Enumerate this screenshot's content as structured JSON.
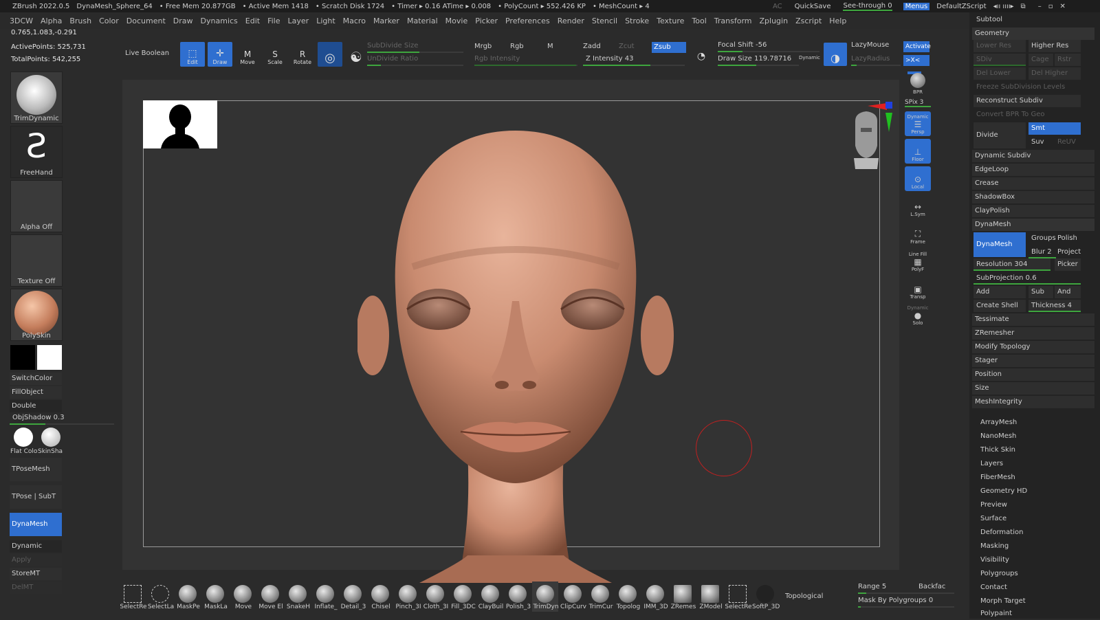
{
  "titlebar": {
    "app": "ZBrush 2022.0.5",
    "doc": "DynaMesh_Sphere_64",
    "free_mem": "• Free Mem 20.877GB",
    "active_mem": "• Active Mem 1418",
    "scratch": "• Scratch Disk 1724",
    "timer": "• Timer ▸ 0.16 ATime ▸ 0.008",
    "poly": "• PolyCount ▸ 552.426 KP",
    "mesh": "• MeshCount ▸ 4",
    "ac": "AC",
    "quicksave": "QuickSave",
    "seethrough": "See-through  0",
    "menus": "Menus",
    "script": "DefaultZScript"
  },
  "menu": [
    "3DCW",
    "Alpha",
    "Brush",
    "Color",
    "Document",
    "Draw",
    "Dynamics",
    "Edit",
    "File",
    "Layer",
    "Light",
    "Macro",
    "Marker",
    "Material",
    "Movie",
    "Picker",
    "Preferences",
    "Render",
    "Stencil",
    "Stroke",
    "Texture",
    "Tool",
    "Transform",
    "Zplugin",
    "Zscript",
    "Help"
  ],
  "coords": "0.765,1.083,-0.291",
  "stats": {
    "active": "ActivePoints: 525,731",
    "total": "TotalPoints: 542,255"
  },
  "toolbar": {
    "live_boolean": "Live Boolean",
    "edit": "Edit",
    "draw": "Draw",
    "move": "Move",
    "scale": "Scale",
    "rotate": "Rotate",
    "subdivide_size": "SubDivide Size",
    "undivide_ratio": "UnDivide Ratio",
    "mrgb": "Mrgb",
    "rgb": "Rgb",
    "m": "M",
    "rgb_intensity": "Rgb Intensity",
    "zadd": "Zadd",
    "zcut": "Zcut",
    "zsub": "Zsub",
    "z_intensity": "Z Intensity 43",
    "focal_shift": "Focal Shift -56",
    "draw_size": "Draw Size 119.78716",
    "dynamic": "Dynamic",
    "lazymouse": "LazyMouse",
    "lazyradius": "LazyRadius",
    "activate": "Activate",
    "x_toggle": ">X<"
  },
  "left": {
    "brush": "TrimDynamic",
    "stroke": "FreeHand",
    "alpha": "Alpha Off",
    "texture": "Texture Off",
    "material": "PolySkin",
    "switchcolor": "SwitchColor",
    "fillobject": "FillObject",
    "double": "Double",
    "objshadow": "ObjShadow",
    "objshadow_val": "0.3",
    "flat": "Flat Colo",
    "skin": "SkinSha",
    "tpose": "TPoseMesh",
    "tposesub": "TPose | SubT",
    "dynamesh": "DynaMesh",
    "dynamic": "Dynamic",
    "apply": "Apply",
    "storemt": "StoreMT",
    "delmt": "DelMT"
  },
  "nav": {
    "bpr": "BPR",
    "spix": "SPix 3",
    "persp": "Persp",
    "dynamic": "Dynamic",
    "floor": "Floor",
    "local": "Local",
    "lsym": "L.Sym",
    "frame": "Frame",
    "linefill": "Line Fill",
    "polyf": "PolyF",
    "transp": "Transp",
    "dyn2": "Dynamic",
    "solo": "Solo"
  },
  "right": {
    "subtool": "Subtool",
    "geometry": "Geometry",
    "lower_res": "Lower Res",
    "higher_res": "Higher Res",
    "sdiv": "SDiv",
    "cage": "Cage",
    "rstr": "Rstr",
    "del_lower": "Del Lower",
    "del_higher": "Del Higher",
    "freeze": "Freeze SubDivision Levels",
    "reconstruct": "Reconstruct Subdiv",
    "convert_bpr": "Convert BPR To Geo",
    "divide": "Divide",
    "smt": "Smt",
    "suv": "Suv",
    "reuv": "ReUV",
    "dynamic_subdiv": "Dynamic Subdiv",
    "edgeloop": "EdgeLoop",
    "crease": "Crease",
    "shadowbox": "ShadowBox",
    "claypolish": "ClayPolish",
    "dynamesh": "DynaMesh",
    "dynamesh_btn": "DynaMesh",
    "groups": "Groups",
    "polish": "Polish",
    "blur": "Blur 2",
    "project": "Project",
    "resolution": "Resolution 304",
    "picker": "Picker",
    "subprojection": "SubProjection 0.6",
    "add": "Add",
    "sub": "Sub",
    "and": "And",
    "create_shell": "Create Shell",
    "thickness": "Thickness 4",
    "tessimate": "Tessimate",
    "zremesher": "ZRemesher",
    "modify_topology": "Modify Topology",
    "stager": "Stager",
    "position": "Position",
    "size": "Size",
    "meshintegrity": "MeshIntegrity",
    "subs": [
      "ArrayMesh",
      "NanoMesh",
      "Thick Skin",
      "Layers",
      "FiberMesh",
      "Geometry HD",
      "Preview",
      "Surface",
      "Deformation",
      "Masking",
      "Visibility",
      "Polygroups",
      "Contact",
      "Morph Target",
      "Polypaint"
    ]
  },
  "bottom": {
    "brushes": [
      "SelectRe",
      "SelectLa",
      "MaskPe",
      "MaskLa",
      "Move",
      "Move El",
      "SnakeH",
      "Inflate_",
      "Detail_3",
      "Chisel",
      "Pinch_3I",
      "Cloth_3I",
      "Fill_3DC",
      "ClayBuil",
      "Polish_3",
      "TrimDyn",
      "ClipCurv",
      "TrimCur",
      "Topolog",
      "IMM_3D",
      "ZRemes",
      "ZModel",
      "SelectRe",
      "SoftP_3D"
    ],
    "topological": "Topological",
    "range": "Range 5",
    "backface": "Backfac",
    "mask_polygroups": "Mask By Polygroups 0"
  }
}
